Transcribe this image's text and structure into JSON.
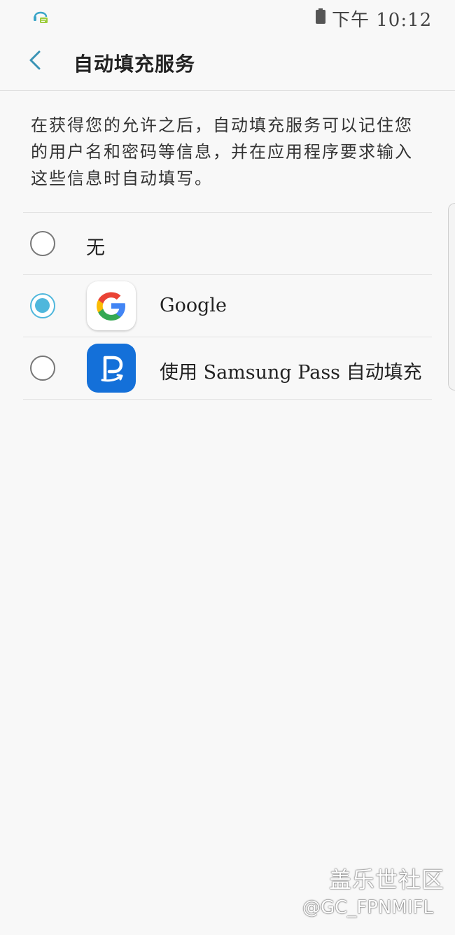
{
  "status_bar": {
    "time": "下午 10:12"
  },
  "header": {
    "title": "自动填充服务",
    "back_icon": "back-chevron-icon"
  },
  "description": "在获得您的允许之后，自动填充服务可以记住您的用户名和密码等信息，并在应用程序要求输入这些信息时自动填写。",
  "options": [
    {
      "label": "无",
      "selected": false
    },
    {
      "label": "Google",
      "selected": true,
      "icon": "google-logo-icon"
    },
    {
      "label": "使用 Samsung Pass 自动填充",
      "selected": false,
      "icon": "samsung-pass-icon"
    }
  ],
  "watermark": {
    "site": "盖乐世社区",
    "user": "@GC_FPNMIFL"
  },
  "colors": {
    "accent": "#4fb7dc",
    "samsung_pass_blue": "#1470d9",
    "background": "#f8f8f8"
  }
}
